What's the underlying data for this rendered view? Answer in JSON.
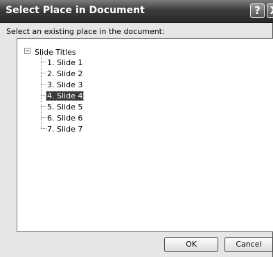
{
  "window": {
    "title": "Select Place in Document",
    "help_label": "?",
    "close_label": "X"
  },
  "prompt": "Select an existing place in the document:",
  "tree": {
    "root_label": "Slide Titles",
    "items": [
      {
        "label": "1. Slide 1"
      },
      {
        "label": "2. Slide 2"
      },
      {
        "label": "3. Slide 3"
      },
      {
        "label": "4. Slide 4",
        "selected": true
      },
      {
        "label": "5. Slide 5"
      },
      {
        "label": "6. Slide 6"
      },
      {
        "label": "7. Slide 7"
      }
    ]
  },
  "buttons": {
    "ok": "OK",
    "cancel": "Cancel"
  }
}
